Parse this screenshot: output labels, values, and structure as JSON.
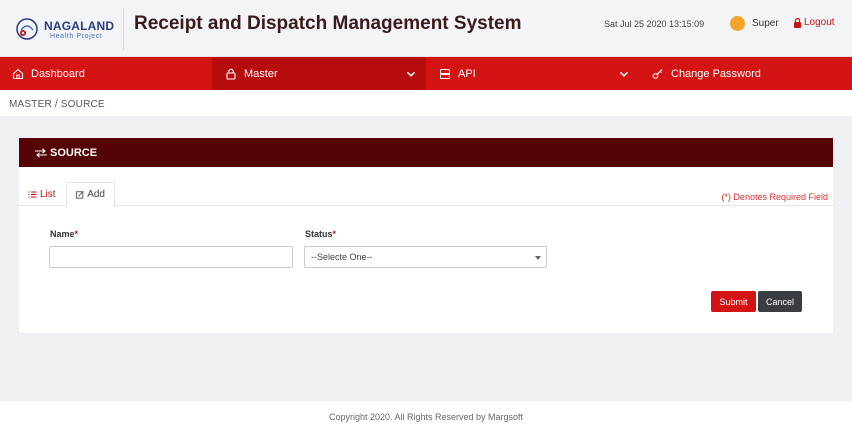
{
  "header": {
    "logo_title": "NAGALAND",
    "logo_subtitle": "Health Project",
    "app_title": "Receipt and Dispatch Management System",
    "datetime": "Sat Jul 25 2020 13:15:09",
    "user_name": "Super",
    "logout_label": "Logout"
  },
  "nav": {
    "items": [
      {
        "label": "Dashboard",
        "icon": "home-icon",
        "active": false,
        "dropdown": false
      },
      {
        "label": "Master",
        "icon": "lock-icon",
        "active": true,
        "dropdown": true
      },
      {
        "label": "API",
        "icon": "server-icon",
        "active": false,
        "dropdown": true
      },
      {
        "label": "Change Password",
        "icon": "key-icon",
        "active": false,
        "dropdown": false
      }
    ]
  },
  "breadcrumb": "MASTER  /  SOURCE",
  "card": {
    "title": "SOURCE",
    "tabs": [
      {
        "label": "List",
        "icon": "list-icon"
      },
      {
        "label": "Add",
        "icon": "edit-icon"
      }
    ],
    "required_note": "(*) Denotes Required Field",
    "fields": {
      "name_label": "Name",
      "name_value": "",
      "status_label": "Status",
      "status_selected": "--Selecte One--"
    },
    "submit_label": "Submit",
    "cancel_label": "Cancel"
  },
  "footer": "Copyright 2020. All Rights Reserved by Margsoft",
  "colors": {
    "primary_red": "#d41414",
    "active_nav": "#b80d0d",
    "card_header": "#540404",
    "cancel_dark": "#3a3d42"
  }
}
